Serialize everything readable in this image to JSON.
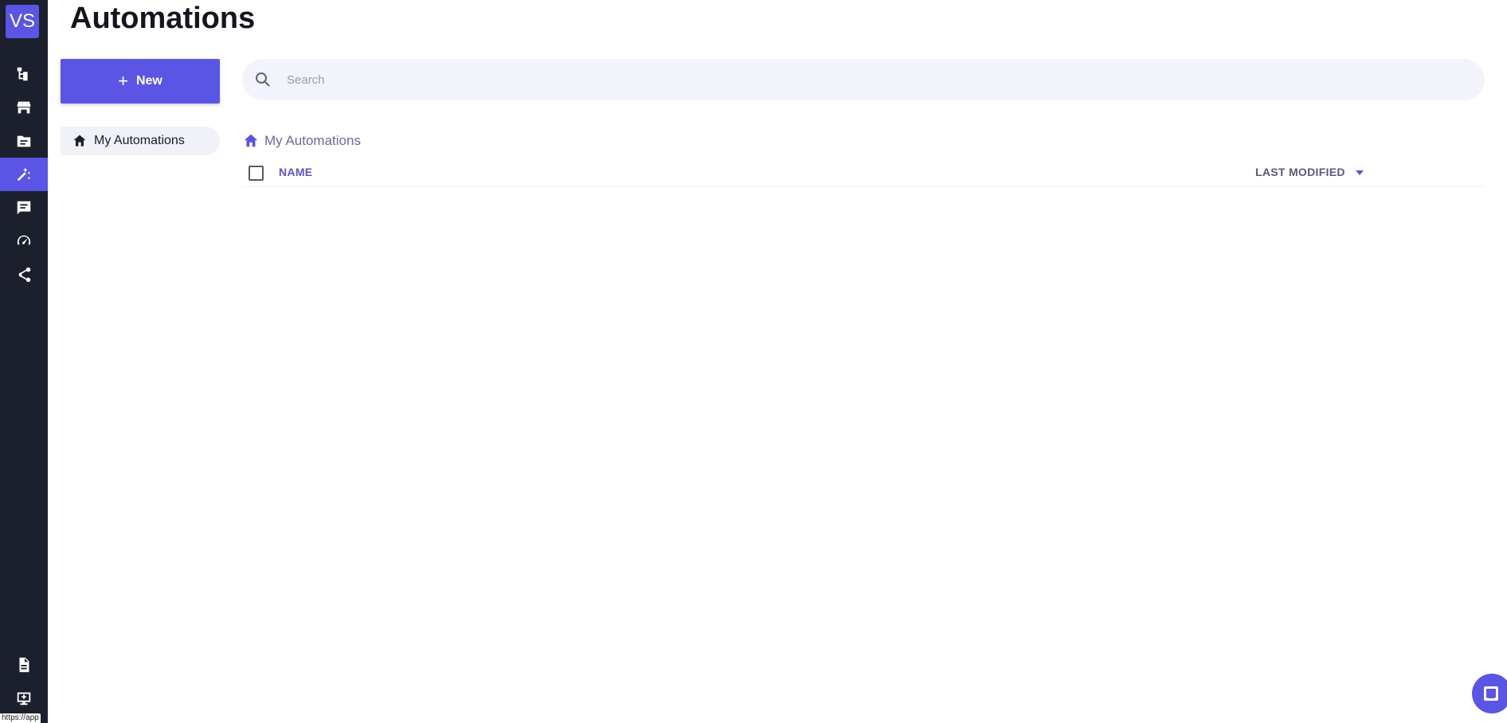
{
  "app": {
    "logo_text": "VS",
    "accent_color": "#5b55e6",
    "rail_color": "#1b202c"
  },
  "rail": {
    "items": [
      {
        "icon": "org-chart-icon",
        "active": false
      },
      {
        "icon": "store-icon",
        "active": false
      },
      {
        "icon": "folder-icon",
        "active": false
      },
      {
        "icon": "magic-wand-icon",
        "active": true
      },
      {
        "icon": "chat-icon",
        "active": false
      },
      {
        "icon": "speedometer-icon",
        "active": false
      },
      {
        "icon": "share-icon",
        "active": false
      },
      {
        "icon": "document-icon",
        "active": false
      },
      {
        "icon": "add-screen-icon",
        "active": false
      }
    ],
    "status_url": "https://app"
  },
  "page": {
    "title": "Automations"
  },
  "toolbar": {
    "new_label": "New",
    "search_placeholder": "Search"
  },
  "folders": {
    "items": [
      {
        "label": "My Automations",
        "icon": "home-icon",
        "selected": true
      }
    ]
  },
  "breadcrumb": {
    "label": "My Automations",
    "icon": "home-icon"
  },
  "table": {
    "columns": {
      "name": "NAME",
      "last_modified": "LAST MODIFIED"
    },
    "sort_icon": "caret-down-icon",
    "rows": []
  },
  "support": {
    "icon": "chat-bubble-icon"
  }
}
